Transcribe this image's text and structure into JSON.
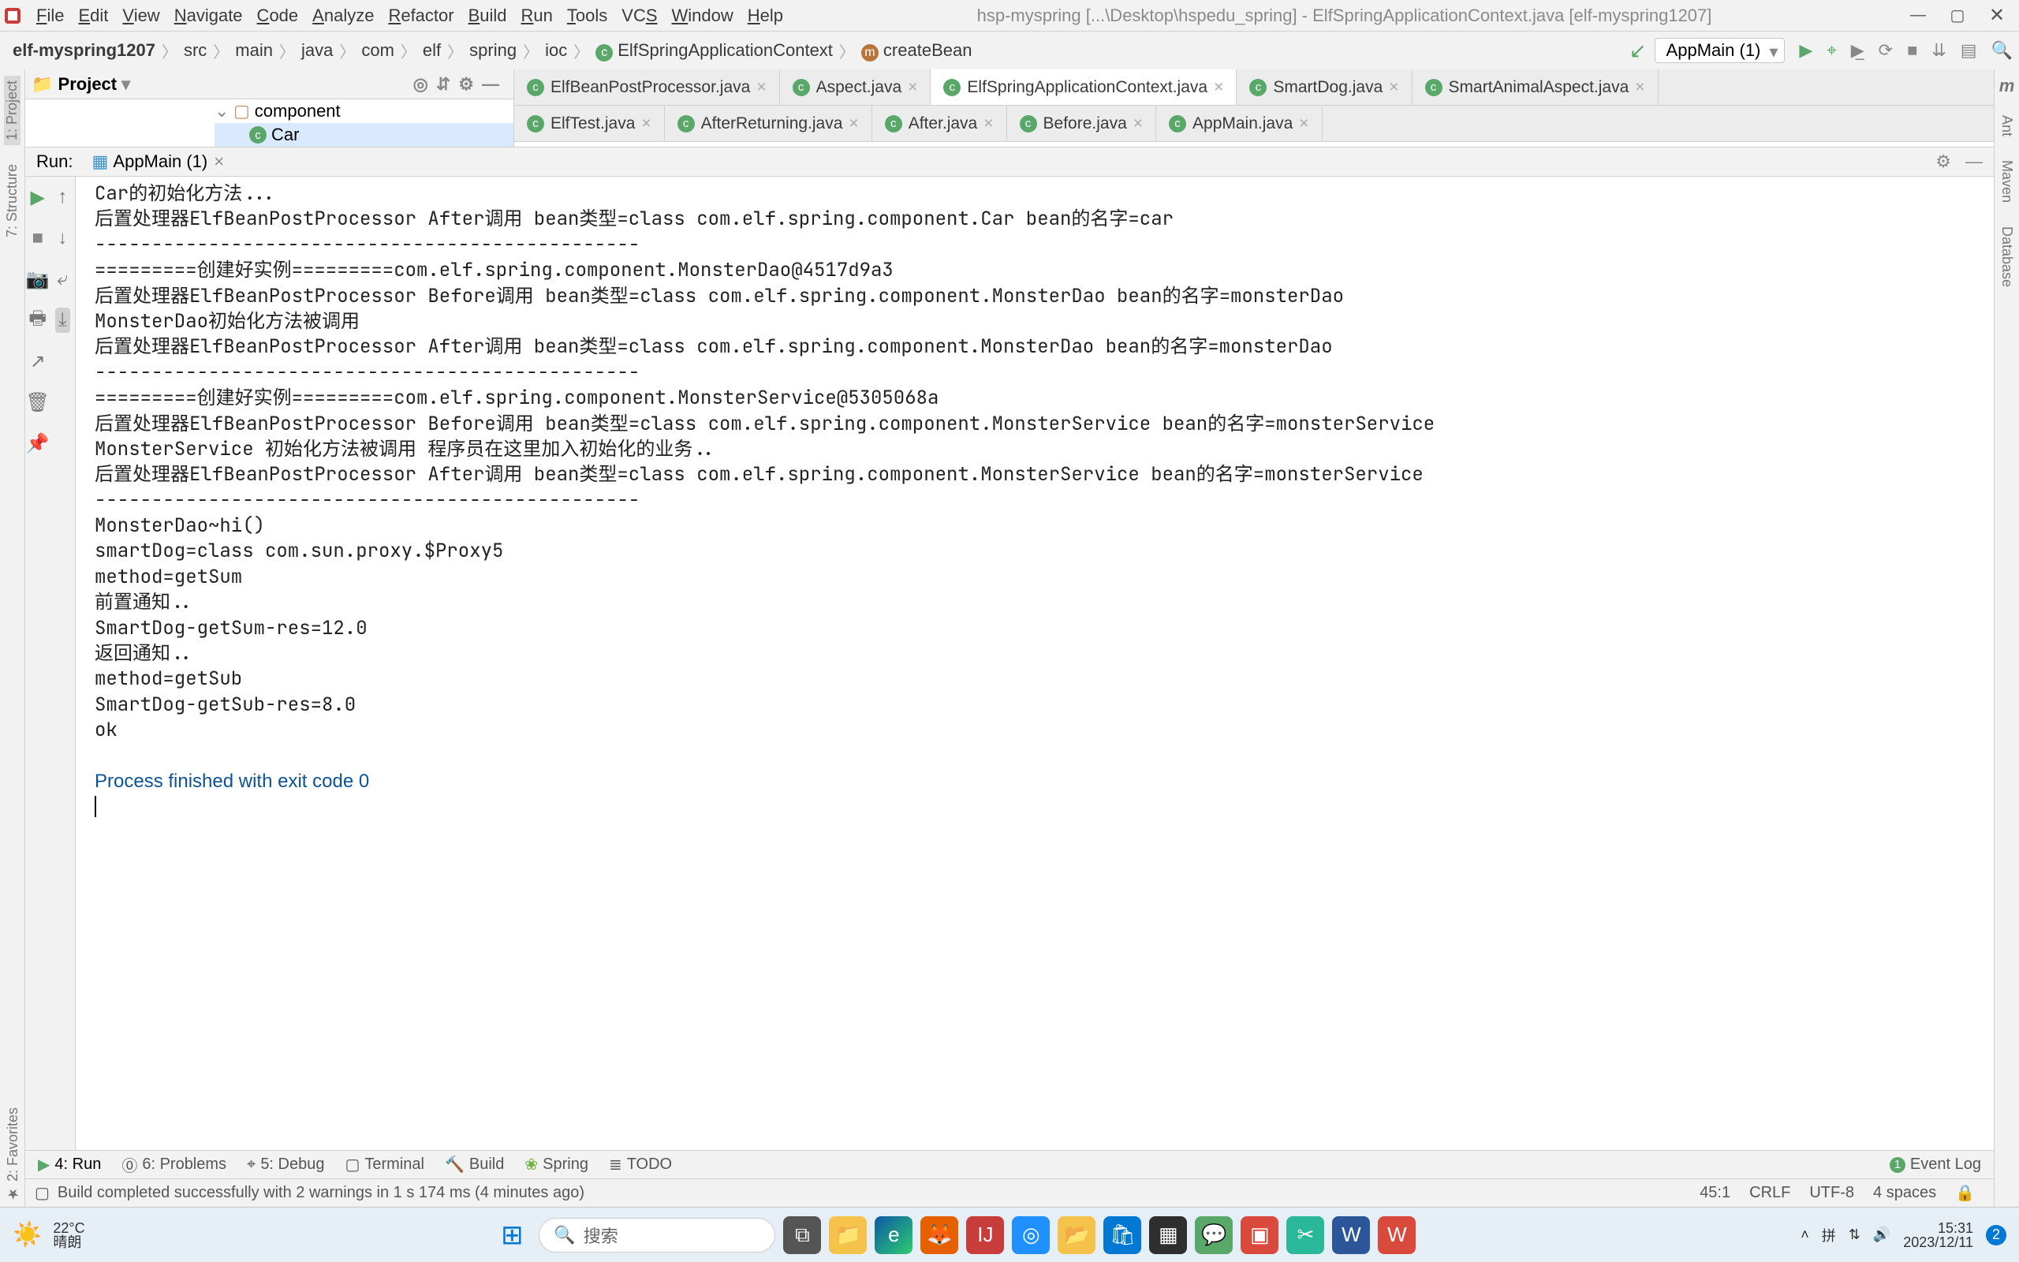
{
  "window": {
    "title": "hsp-myspring [...\\Desktop\\hspedu_spring] - ElfSpringApplicationContext.java [elf-myspring1207]"
  },
  "menu": [
    "File",
    "Edit",
    "View",
    "Navigate",
    "Code",
    "Analyze",
    "Refactor",
    "Build",
    "Run",
    "Tools",
    "VCS",
    "Window",
    "Help"
  ],
  "breadcrumbs": {
    "items": [
      "elf-myspring1207",
      "src",
      "main",
      "java",
      "com",
      "elf",
      "spring",
      "ioc"
    ],
    "class": "ElfSpringApplicationContext",
    "method": "createBean"
  },
  "run_config": "AppMain (1)",
  "left_tools": [
    "1: Project",
    "7: Structure",
    "2: Favorites"
  ],
  "right_tools": [
    "Ant",
    "Maven",
    "Database"
  ],
  "right_tools_bold": "m",
  "project": {
    "header": "Project",
    "node_component": "component",
    "node_selected": "Car"
  },
  "editor_tabs_row1": [
    "ElfBeanPostProcessor.java",
    "Aspect.java",
    "ElfSpringApplicationContext.java",
    "SmartDog.java",
    "SmartAnimalAspect.java"
  ],
  "editor_tabs_row2": [
    "ElfTest.java",
    "AfterReturning.java",
    "After.java",
    "Before.java",
    "AppMain.java"
  ],
  "editor_active_tab": 2,
  "run_panel": {
    "label": "Run:",
    "config": "AppMain (1)"
  },
  "console_lines": [
    "Car的初始化方法...",
    "后置处理器ElfBeanPostProcessor After调用 bean类型=class com.elf.spring.component.Car bean的名字=car",
    "------------------------------------------------",
    "=========创建好实例=========com.elf.spring.component.MonsterDao@4517d9a3",
    "后置处理器ElfBeanPostProcessor Before调用 bean类型=class com.elf.spring.component.MonsterDao bean的名字=monsterDao",
    "MonsterDao初始化方法被调用",
    "后置处理器ElfBeanPostProcessor After调用 bean类型=class com.elf.spring.component.MonsterDao bean的名字=monsterDao",
    "------------------------------------------------",
    "=========创建好实例=========com.elf.spring.component.MonsterService@5305068a",
    "后置处理器ElfBeanPostProcessor Before调用 bean类型=class com.elf.spring.component.MonsterService bean的名字=monsterService",
    "MonsterService 初始化方法被调用 程序员在这里加入初始化的业务..",
    "后置处理器ElfBeanPostProcessor After调用 bean类型=class com.elf.spring.component.MonsterService bean的名字=monsterService",
    "------------------------------------------------",
    "MonsterDao~hi()",
    "smartDog=class com.sun.proxy.$Proxy5",
    "method=getSum",
    "前置通知..",
    "SmartDog-getSum-res=12.0",
    "返回通知..",
    "method=getSub",
    "SmartDog-getSub-res=8.0",
    "ok",
    ""
  ],
  "console_exit": "Process finished with exit code 0",
  "bottom_tabs": {
    "run": "4: Run",
    "problems": "6: Problems",
    "debug": "5: Debug",
    "terminal": "Terminal",
    "build": "Build",
    "spring": "Spring",
    "todo": "TODO",
    "event_log": "Event Log",
    "event_log_badge": "1"
  },
  "status": {
    "msg": "Build completed successfully with 2 warnings in 1 s 174 ms (4 minutes ago)",
    "caret": "45:1",
    "eol": "CRLF",
    "enc": "UTF-8",
    "spaces": "4 spaces"
  },
  "taskbar": {
    "temp": "22°C",
    "cond": "晴朗",
    "search": "搜索",
    "time": "15:31",
    "date": "2023/12/11",
    "notify": "2"
  }
}
